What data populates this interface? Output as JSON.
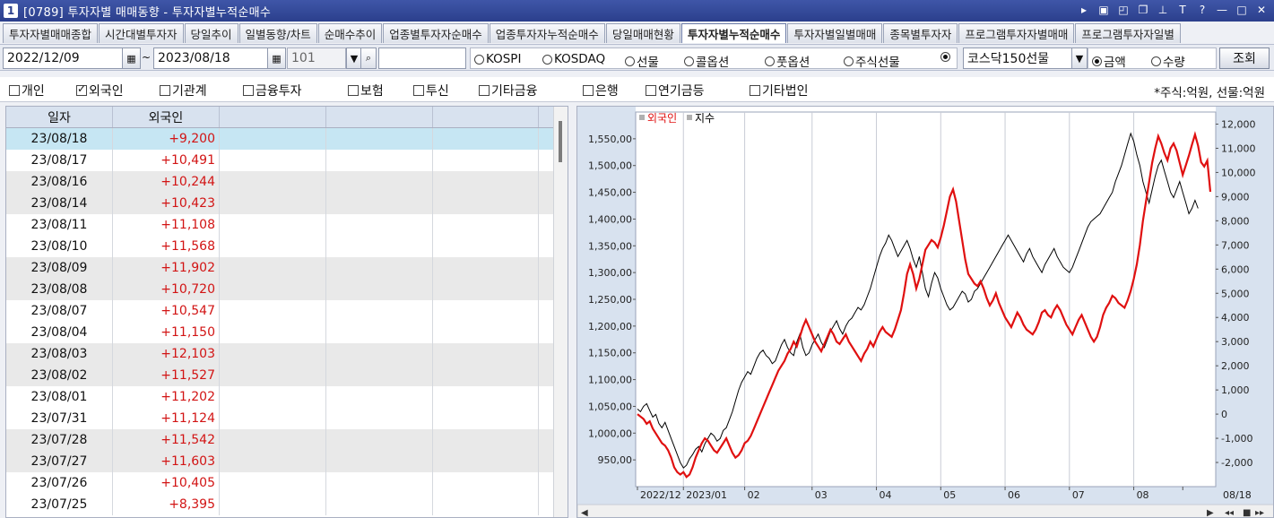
{
  "window": {
    "number": "1",
    "title": "[0789] 투자자별 매매동향 - 투자자별누적순매수"
  },
  "tabs": [
    {
      "label": "투자자별매매종합"
    },
    {
      "label": "시간대별투자자"
    },
    {
      "label": "당일추이"
    },
    {
      "label": "일별동향/차트"
    },
    {
      "label": "순매수추이"
    },
    {
      "label": "업종별투자자순매수"
    },
    {
      "label": "업종투자자누적순매수"
    },
    {
      "label": "당일매매현황"
    },
    {
      "label": "투자자별누적순매수"
    },
    {
      "label": "투자자별일별매매"
    },
    {
      "label": "종목별투자자"
    },
    {
      "label": "프로그램투자자별매매"
    },
    {
      "label": "프로그램투자자일별"
    }
  ],
  "filter": {
    "start_date": "2022/12/09",
    "tilde": "~",
    "end_date": "2023/08/18",
    "code": "101",
    "markets": [
      {
        "label": "KOSPI",
        "selected": false
      },
      {
        "label": "KOSDAQ",
        "selected": false
      },
      {
        "label": "선물",
        "selected": false
      },
      {
        "label": "콜옵션",
        "selected": false
      },
      {
        "label": "풋옵션",
        "selected": false
      },
      {
        "label": "주식선물",
        "selected": false
      },
      {
        "label": "",
        "selected": true
      }
    ],
    "market_select": "코스닥150선물",
    "measure_options": [
      {
        "label": "금액",
        "selected": true
      },
      {
        "label": "수량",
        "selected": false
      }
    ],
    "query_label": "조회"
  },
  "investors": [
    {
      "label": "개인",
      "checked": false
    },
    {
      "label": "외국인",
      "checked": true
    },
    {
      "label": "기관계",
      "checked": false
    },
    {
      "label": "금융투자",
      "checked": false
    },
    {
      "label": "보험",
      "checked": false
    },
    {
      "label": "투신",
      "checked": false
    },
    {
      "label": "기타금융",
      "checked": false
    },
    {
      "label": "은행",
      "checked": false
    },
    {
      "label": "연기금등",
      "checked": false
    },
    {
      "label": "기타법인",
      "checked": false
    }
  ],
  "unit_note": "*주식:억원, 선물:억원",
  "table": {
    "headers": [
      "일자",
      "외국인",
      "",
      "",
      "",
      ""
    ],
    "rows": [
      {
        "date": "23/08/18",
        "value": "+9,200"
      },
      {
        "date": "23/08/17",
        "value": "+10,491"
      },
      {
        "date": "23/08/16",
        "value": "+10,244"
      },
      {
        "date": "23/08/14",
        "value": "+10,423"
      },
      {
        "date": "23/08/11",
        "value": "+11,108"
      },
      {
        "date": "23/08/10",
        "value": "+11,568"
      },
      {
        "date": "23/08/09",
        "value": "+11,902"
      },
      {
        "date": "23/08/08",
        "value": "+10,720"
      },
      {
        "date": "23/08/07",
        "value": "+10,547"
      },
      {
        "date": "23/08/04",
        "value": "+11,150"
      },
      {
        "date": "23/08/03",
        "value": "+12,103"
      },
      {
        "date": "23/08/02",
        "value": "+11,527"
      },
      {
        "date": "23/08/01",
        "value": "+11,202"
      },
      {
        "date": "23/07/31",
        "value": "+11,124"
      },
      {
        "date": "23/07/28",
        "value": "+11,542"
      },
      {
        "date": "23/07/27",
        "value": "+11,603"
      },
      {
        "date": "23/07/26",
        "value": "+10,405"
      },
      {
        "date": "23/07/25",
        "value": "+8,395"
      }
    ]
  },
  "colors": {
    "foreign_line": "#e01010",
    "index_line": "#000000",
    "axis_bg": "#d8e2ef",
    "value_red": "#d21414"
  },
  "chart_data": {
    "type": "line",
    "legend": [
      "외국인",
      "지수"
    ],
    "legend_placement": "top-left",
    "left_axis": {
      "ticks": [
        "1,550,00",
        "1,500,00",
        "1,450,00",
        "1,400,00",
        "1,350,00",
        "1,300,00",
        "1,250,00",
        "1,200,00",
        "1,150,00",
        "1,100,00",
        "1,050,00",
        "1,000,00",
        "950,00"
      ],
      "ylim": [
        900,
        1600
      ]
    },
    "right_axis": {
      "ticks": [
        "12,000",
        "11,000",
        "10,000",
        "9,000",
        "8,000",
        "7,000",
        "6,000",
        "5,000",
        "4,000",
        "3,000",
        "2,000",
        "1,000",
        "0",
        "-1,000",
        "-2,000"
      ],
      "ylim": [
        -3000,
        12500
      ]
    },
    "x_labels": [
      "2022/12",
      "2023/01",
      "02",
      "03",
      "04",
      "05",
      "06",
      "07",
      "08",
      "08/18"
    ],
    "x_label_positions": [
      0,
      15,
      35,
      57,
      78,
      99,
      120,
      141,
      162,
      178
    ],
    "grid": true,
    "series": [
      {
        "name": "외국인",
        "axis": "right",
        "values": [
          0,
          -100,
          -200,
          -400,
          -300,
          -600,
          -800,
          -1000,
          -1200,
          -1300,
          -1500,
          -1800,
          -2200,
          -2400,
          -2500,
          -2400,
          -2600,
          -2500,
          -2200,
          -1800,
          -1500,
          -1200,
          -1000,
          -1100,
          -1300,
          -1500,
          -1600,
          -1400,
          -1200,
          -1000,
          -1300,
          -1600,
          -1800,
          -1700,
          -1500,
          -1200,
          -1100,
          -900,
          -600,
          -300,
          0,
          300,
          600,
          900,
          1200,
          1500,
          1800,
          2000,
          2200,
          2500,
          2700,
          3000,
          2800,
          3200,
          3600,
          3900,
          3600,
          3300,
          3000,
          2800,
          2600,
          2900,
          3200,
          3500,
          3300,
          3000,
          2900,
          3100,
          3300,
          3000,
          2800,
          2600,
          2400,
          2200,
          2500,
          2700,
          3000,
          2800,
          3100,
          3400,
          3600,
          3400,
          3300,
          3200,
          3500,
          3900,
          4300,
          5000,
          5800,
          6200,
          5800,
          5200,
          5600,
          6200,
          6800,
          7000,
          7200,
          7100,
          6900,
          7300,
          7800,
          8400,
          9000,
          9300,
          8800,
          8000,
          7200,
          6400,
          5800,
          5600,
          5400,
          5300,
          5500,
          5200,
          4800,
          4500,
          4700,
          5000,
          4600,
          4300,
          4000,
          3800,
          3600,
          3900,
          4200,
          4000,
          3700,
          3500,
          3400,
          3300,
          3500,
          3800,
          4200,
          4300,
          4100,
          4000,
          4300,
          4500,
          4300,
          4000,
          3700,
          3500,
          3300,
          3600,
          3900,
          4100,
          3800,
          3500,
          3200,
          3000,
          3200,
          3600,
          4100,
          4400,
          4600,
          4900,
          4800,
          4600,
          4500,
          4400,
          4700,
          5100,
          5600,
          6200,
          7000,
          8000,
          8800,
          9600,
          10400,
          11000,
          11500,
          11200,
          10800,
          10500,
          11000,
          11200,
          10900,
          10400,
          9900,
          10300,
          10700,
          11150,
          11568,
          11108,
          10423,
          10244,
          10491,
          9200
        ]
      },
      {
        "name": "지수",
        "axis": "left",
        "values": [
          1045,
          1040,
          1050,
          1055,
          1042,
          1030,
          1035,
          1018,
          1010,
          1020,
          1005,
          990,
          975,
          960,
          945,
          935,
          940,
          952,
          960,
          970,
          975,
          965,
          980,
          990,
          1000,
          995,
          985,
          990,
          1005,
          1010,
          1025,
          1040,
          1060,
          1080,
          1095,
          1105,
          1115,
          1110,
          1125,
          1140,
          1150,
          1155,
          1145,
          1140,
          1130,
          1135,
          1150,
          1165,
          1175,
          1160,
          1150,
          1145,
          1170,
          1185,
          1160,
          1145,
          1150,
          1165,
          1175,
          1185,
          1170,
          1160,
          1175,
          1190,
          1200,
          1210,
          1195,
          1185,
          1200,
          1210,
          1215,
          1225,
          1235,
          1230,
          1240,
          1255,
          1270,
          1290,
          1310,
          1330,
          1345,
          1355,
          1370,
          1360,
          1345,
          1330,
          1340,
          1350,
          1360,
          1345,
          1325,
          1310,
          1330,
          1300,
          1270,
          1255,
          1280,
          1300,
          1290,
          1270,
          1255,
          1240,
          1230,
          1235,
          1245,
          1255,
          1265,
          1260,
          1245,
          1250,
          1265,
          1270,
          1280,
          1290,
          1300,
          1310,
          1320,
          1330,
          1340,
          1350,
          1360,
          1370,
          1360,
          1350,
          1340,
          1330,
          1320,
          1335,
          1345,
          1330,
          1320,
          1310,
          1300,
          1315,
          1325,
          1335,
          1345,
          1330,
          1320,
          1310,
          1305,
          1300,
          1310,
          1325,
          1340,
          1355,
          1370,
          1385,
          1395,
          1400,
          1405,
          1410,
          1420,
          1430,
          1440,
          1450,
          1470,
          1485,
          1500,
          1520,
          1540,
          1560,
          1545,
          1520,
          1500,
          1470,
          1450,
          1430,
          1455,
          1480,
          1500,
          1510,
          1490,
          1470,
          1450,
          1440,
          1455,
          1470,
          1450,
          1430,
          1410,
          1420,
          1435,
          1420
        ]
      }
    ]
  }
}
